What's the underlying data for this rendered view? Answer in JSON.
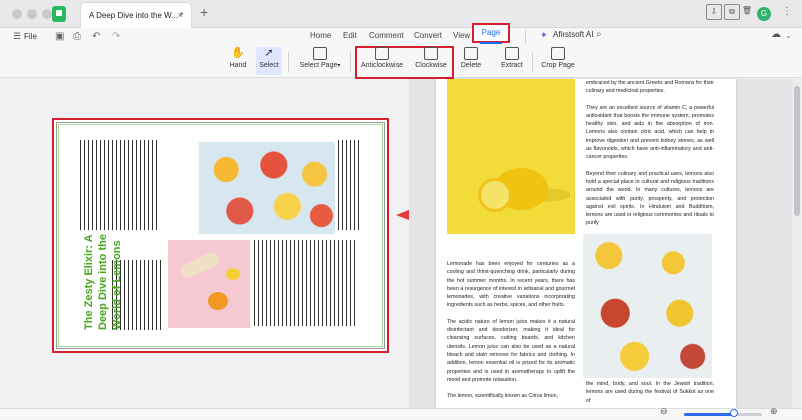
{
  "titlebar": {
    "tab_title": "A Deep Dive into the W...",
    "tab_modified": "*",
    "tab_close": "×",
    "new_tab": "+",
    "avatar_letter": "G"
  },
  "menu": {
    "file": "File",
    "items": [
      "Home",
      "Edit",
      "Comment",
      "Convert",
      "View",
      "Page"
    ],
    "active": "Page",
    "ai": "Afirstsoft AI",
    "accent": "#1a6cf5",
    "highlight": "#d4202d"
  },
  "toolbar": {
    "hand": "Hand",
    "select": "Select",
    "select_page": "Select Page",
    "anticlockwise": "Anticlockwise",
    "clockwise": "Clockwise",
    "delete": "Delete",
    "extract": "Extract",
    "crop_page": "Crop Page"
  },
  "thumbnail": {
    "title_lines": [
      "The Zesty Elixir: A",
      "Deep Dive into the",
      "World of Lemons"
    ],
    "title_color": "#4aa51e"
  },
  "document": {
    "col2_p1": "embraced by the ancient Greeks and Romans for their culinary and medicinal properties.",
    "col2_p2": "They are an excellent source of vitamin C, a powerful antioxidant that boosts the immune system, promotes healthy skin, and aids in the absorption of iron. Lemons also contain citric acid, which can help to improve digestion and prevent kidney stones, as well as flavonoids, which have anti-inflammatory and anti-cancer properties.",
    "col2_p3": "Beyond their culinary and practical uses, lemons also hold a special place in cultural and religious traditions around the world. In many cultures, lemons are associated with purity, prosperity, and protection against evil spirits. In Hinduism and Buddhism, lemons are used in religious ceremonies and rituals to purify",
    "col2_p4": "the mind, body, and soul. In the Jewish tradition, lemons are used during the festival of Sukkot as one of",
    "col1_p1": "Lemonade has been enjoyed for centuries as a cooling and thirst-quenching drink, particularly during the hot summer months. In recent years, there has been a resurgence of interest in artisanal and gourmet lemonades, with creative variations incorporating ingredients such as herbs, spices, and other fruits.",
    "col1_p2": "The acidic nature of lemon juice makes it a natural disinfectant and deodorizer, making it ideal for cleansing surfaces, cutting boards, and kitchen utensils. Lemon juice can also be used as a natural bleach and stain remover for fabrics and clothing. In addition, lemon essential oil is prized for its aromatic properties and is used in aromatherapy to uplift the mood and promote relaxation.",
    "col1_p3": "The lemon, scientifically known as Citrus limon,"
  },
  "statusbar": {
    "zoom_out": "⊖",
    "zoom_in": "⊕",
    "zoom_fraction": 0.64
  }
}
